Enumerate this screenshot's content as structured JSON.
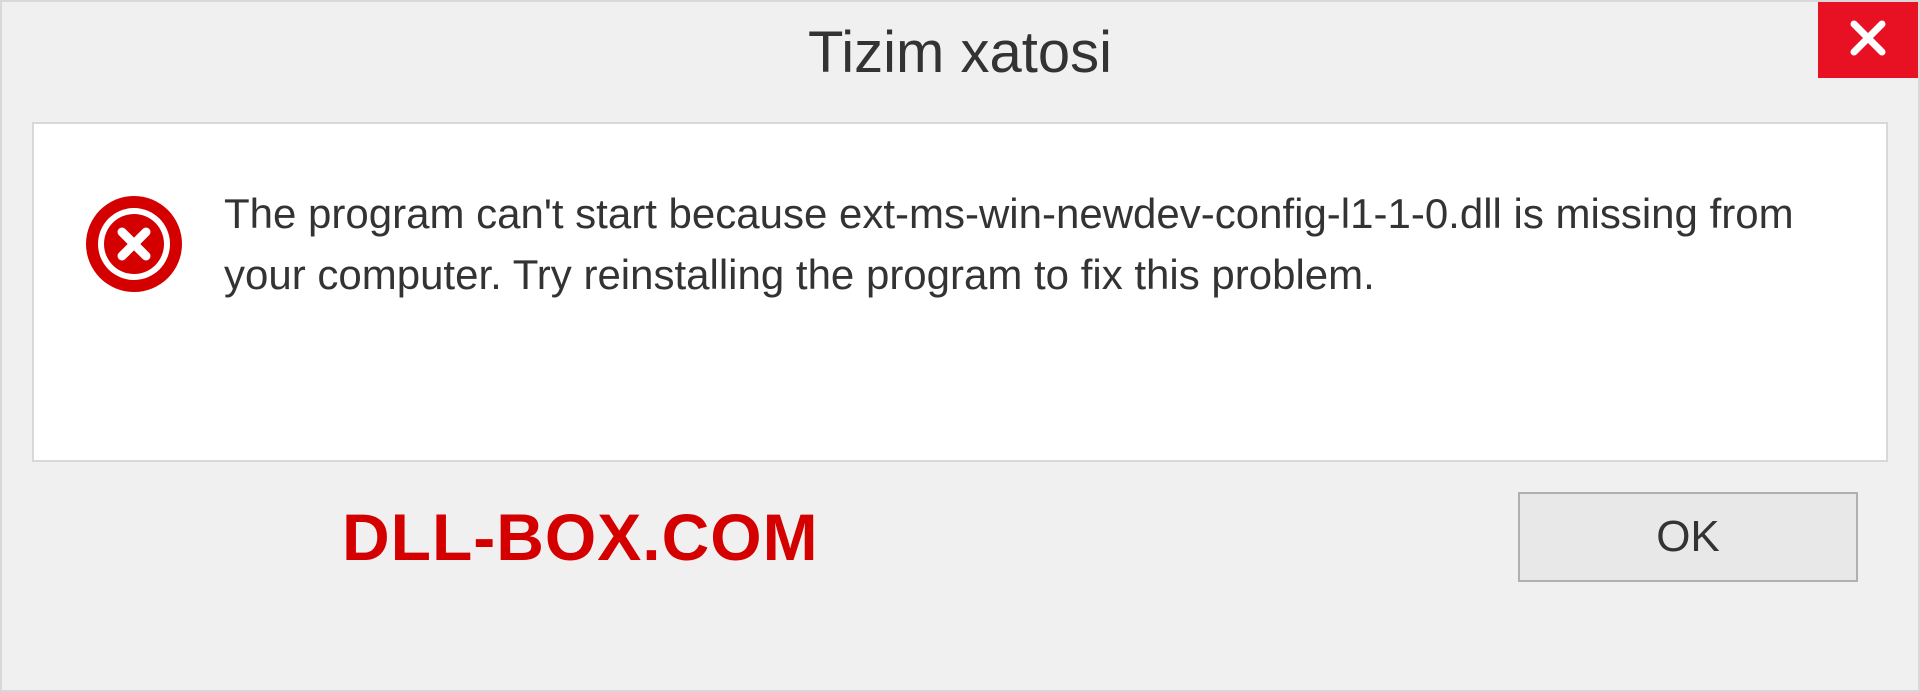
{
  "dialog": {
    "title": "Tizim xatosi",
    "message": "The program can't start because ext-ms-win-newdev-config-l1-1-0.dll is missing from your computer. Try reinstalling the program to fix this problem.",
    "ok_label": "OK",
    "watermark": "DLL-BOX.COM"
  }
}
